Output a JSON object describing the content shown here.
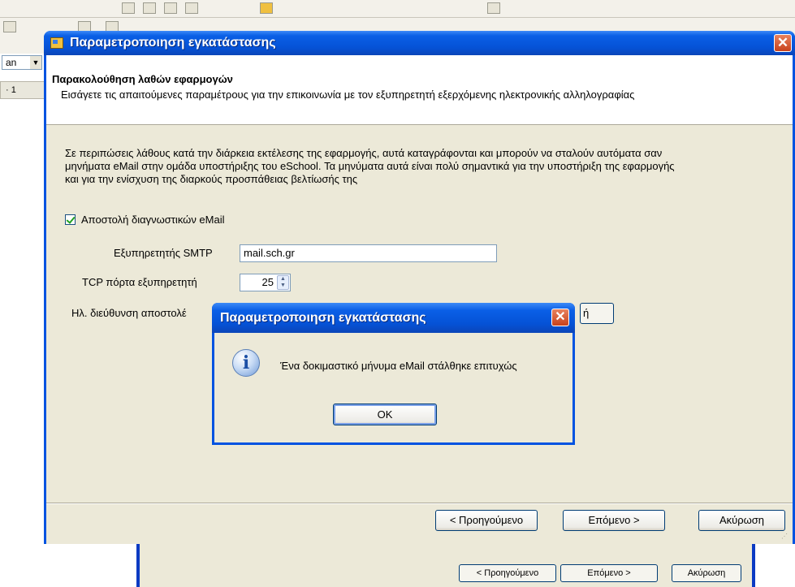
{
  "background_app": {
    "font_combo_value": "an",
    "ruler_text": "· 1"
  },
  "wizard": {
    "title": "Παραμετροποιηση εγκατάστασης",
    "close_glyph": "✕",
    "header_title": "Παρακολούθηση λαθών εφαρμογών",
    "header_description": "Εισάγετε τις απαιτούμενες παραμέτρους για την επικοινωνία με τον εξυπηρετητή εξερχόμενης ηλεκτρονικής αλληλογραφίας",
    "body_text": "Σε περιπώσεις λάθους κατά την διάρκεια εκτέλεσης της εφαρμογής, αυτά καταγράφονται και μπορούν να σταλούν αυτόματα σαν μηνήματα eMail στην ομάδα υποστήριξης του eSchool. Τα μηνύματα αυτά είναι πολύ σημαντικά για την υποστήριξη της εφαρμογής και για την ενίσχυση της διαρκούς προσπάθειας βελτίωσής της",
    "send_diagnostics_label": "Αποστολή διαγνωστικών eMail",
    "send_diagnostics_checked": true,
    "smtp_label": "Εξυπηρετητής SMTP",
    "smtp_value": "mail.sch.gr",
    "port_label": "TCP πόρτα εξυπηρετητή",
    "port_value": "25",
    "sender_label": "Ηλ. διεύθυνση αποστολέ",
    "hidden_button_label": "ή",
    "buttons": {
      "back": "< Προηγούμενο",
      "next": "Επόμενο >",
      "cancel": "Ακύρωση"
    }
  },
  "message_box": {
    "title": "Παραμετροποιηση εγκατάστασης",
    "close_glyph": "✕",
    "icon_glyph": "i",
    "text": "Ένα δοκιμαστικό μήνυμα eMail στάλθηκε επιτυχώς",
    "ok_label": "OK"
  },
  "underlying_window": {
    "back": "< Προηγούμενο",
    "next": "Επόμενο >",
    "cancel": "Ακύρωση"
  },
  "colors": {
    "titlebar_blue": "#0053e1",
    "dialog_face": "#ece9d8",
    "close_red": "#c8421c"
  }
}
